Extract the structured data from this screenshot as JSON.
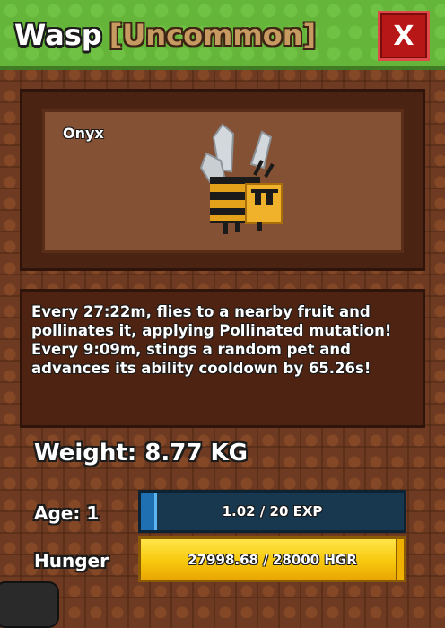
{
  "window": {
    "pet_name": "Wasp",
    "rarity": "[Uncommon]",
    "close_label": "X"
  },
  "preview": {
    "variant": "Onyx"
  },
  "description": {
    "text": "Every 27:22m, flies to a nearby fruit and pollinates it, applying Pollinated mutation! Every 9:09m, stings a random pet and advances its ability cooldown by 65.26s!"
  },
  "stats": {
    "weight_label": "Weight: 8.77 KG",
    "age_label": "Age: 1",
    "exp_text": "1.02 / 20 EXP",
    "exp_progress": 0.051,
    "hunger_label": "Hunger",
    "hunger_text": "27998.68 / 28000 HGR",
    "hunger_progress": 0.99995
  },
  "colors": {
    "header_green": "#64b53a",
    "close_red": "#b81717",
    "exp_blue": "#1f6fb3",
    "hunger_yellow": "#f7c80c"
  },
  "icons": [
    "wasp-pet-model",
    "close-icon"
  ]
}
